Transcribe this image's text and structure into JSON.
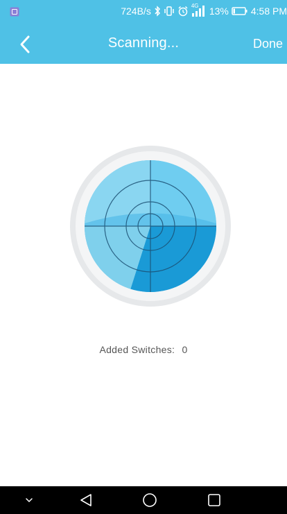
{
  "status_bar": {
    "network_speed": "724B/s",
    "network_type": "4G",
    "battery_percent": "13%",
    "time": "4:58 PM",
    "icons": [
      "notification-icon",
      "bluetooth-icon",
      "vibrate-icon",
      "alarm-icon",
      "signal-icon",
      "battery-icon"
    ]
  },
  "header": {
    "title": "Scanning...",
    "back_icon": "chevron-left-icon",
    "done_label": "Done"
  },
  "main": {
    "radar_icon": "radar-scan-icon",
    "added_label": "Added Switches:",
    "added_count": "0"
  },
  "nav_bar": {
    "icons": [
      "chevron-down-icon",
      "back-triangle-icon",
      "home-circle-icon",
      "recents-square-icon"
    ]
  },
  "colors": {
    "accent": "#4fc1e6",
    "radar_dark": "#1a9ad6",
    "radar_light": "#7fd0ec",
    "ring": "#e6e8ea"
  }
}
